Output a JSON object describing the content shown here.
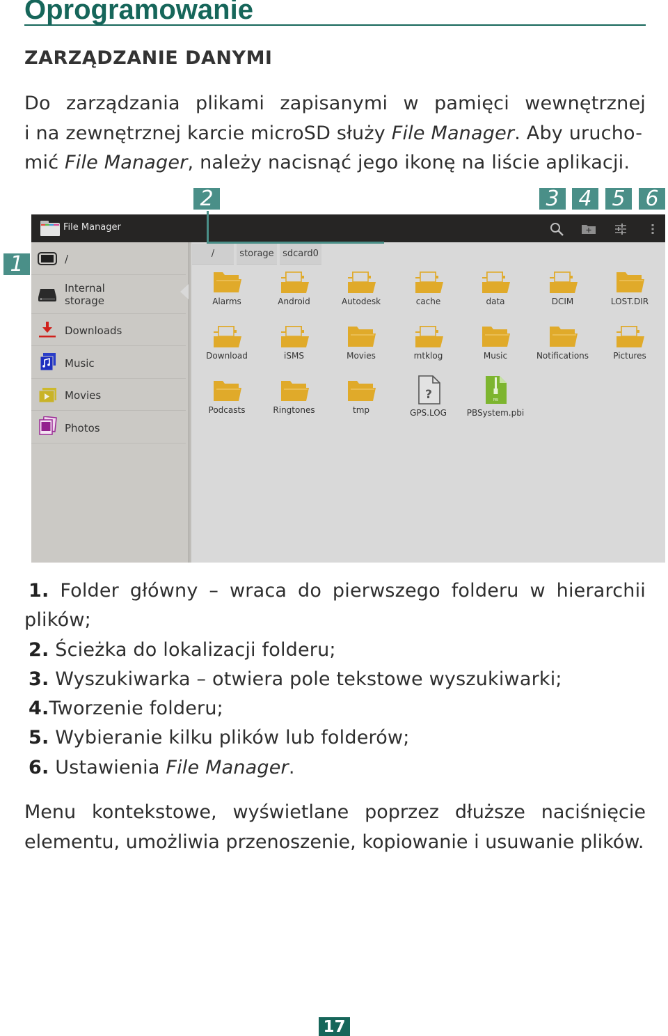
{
  "page": {
    "title": "Oprogramowanie",
    "section_title": "ZARZĄDZANIE DANYMI",
    "intro": {
      "line1": "Do zarządzania plikami zapisanymi w pamięci wewnętrznej",
      "line2_a": "i na zewnętrznej karcie microSD służy ",
      "line2_it": "File Manager",
      "line2_b": ". Aby urucho-",
      "line3_a": "mić ",
      "line3_it": "File Manager",
      "line3_b": ", należy nacisnąć jego ikonę na liście aplikacji."
    },
    "callouts": [
      "1",
      "2",
      "3",
      "4",
      "5",
      "6"
    ],
    "legend": [
      {
        "num": "1.",
        "text": "Folder główny – wraca do pierwszego folderu w hierarchii",
        "cont": "plików;"
      },
      {
        "num": "2.",
        "text": "Ścieżka do lokalizacji folderu;"
      },
      {
        "num": "3.",
        "text": "Wyszukiwarka – otwiera pole tekstowe wyszukiwarki;"
      },
      {
        "num": "4.",
        "text": "Tworzenie folderu;"
      },
      {
        "num": "5.",
        "text": "Wybieranie kilku plików lub folderów;"
      },
      {
        "num": "6.",
        "text_a": "Ustawienia ",
        "text_it": "File Manager",
        "text_b": "."
      }
    ],
    "outro": {
      "line1": "Menu kontekstowe, wyświetlane poprzez dłuższe naciśnięcie",
      "line2": "elementu, umożliwia przenoszenie, kopiowanie i usuwanie plików."
    },
    "page_number": "17"
  },
  "screenshot": {
    "app_title": "File Manager",
    "action_icons": [
      "search-icon",
      "new-folder-icon",
      "select-icon",
      "overflow-menu-icon"
    ],
    "sidebar": [
      {
        "label": "/",
        "icon": "root-device-icon"
      },
      {
        "label": "Internal\nstorage",
        "label_1": "Internal",
        "label_2": "storage",
        "icon": "internal-storage-icon"
      },
      {
        "label": "Downloads",
        "icon": "downloads-icon"
      },
      {
        "label": "Music",
        "icon": "music-icon"
      },
      {
        "label": "Movies",
        "icon": "movies-icon"
      },
      {
        "label": "Photos",
        "icon": "photos-icon"
      }
    ],
    "breadcrumbs": [
      "/",
      "storage",
      "sdcard0"
    ],
    "items": [
      {
        "name": "Alarms",
        "type": "folder-empty"
      },
      {
        "name": "Android",
        "type": "folder-full"
      },
      {
        "name": "Autodesk",
        "type": "folder-full"
      },
      {
        "name": "cache",
        "type": "folder-full"
      },
      {
        "name": "data",
        "type": "folder-full"
      },
      {
        "name": "DCIM",
        "type": "folder-full"
      },
      {
        "name": "LOST.DIR",
        "type": "folder-empty"
      },
      {
        "name": "Download",
        "type": "folder-full"
      },
      {
        "name": "iSMS",
        "type": "folder-full"
      },
      {
        "name": "Movies",
        "type": "folder-empty"
      },
      {
        "name": "mtklog",
        "type": "folder-full"
      },
      {
        "name": "Music",
        "type": "folder-empty"
      },
      {
        "name": "Notifications",
        "type": "folder-empty"
      },
      {
        "name": "Pictures",
        "type": "folder-full"
      },
      {
        "name": "Podcasts",
        "type": "folder-empty"
      },
      {
        "name": "Ringtones",
        "type": "folder-empty"
      },
      {
        "name": "tmp",
        "type": "folder-empty"
      },
      {
        "name": "GPS.LOG",
        "type": "unknown-file"
      },
      {
        "name": "PBSystem.pbi",
        "type": "archive-file"
      }
    ],
    "colors": {
      "accent": "#16665a",
      "callout": "#4a8f88",
      "folder": "#e0aa2a",
      "archive": "#7db52f"
    }
  }
}
